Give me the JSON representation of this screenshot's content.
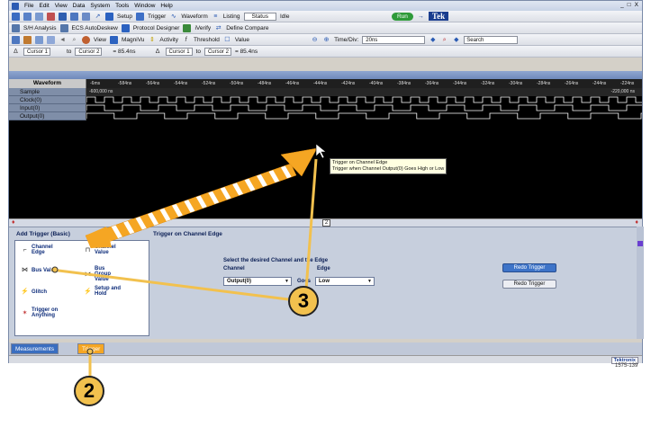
{
  "menu": [
    "File",
    "Edit",
    "View",
    "Data",
    "System",
    "Tools",
    "Window",
    "Help"
  ],
  "window_controls": [
    "_",
    "□",
    "X"
  ],
  "toolbar1": {
    "setup": "Setup",
    "trigger": "Trigger",
    "waveform": "Waveform",
    "listing": "Listing",
    "status_box": "Status",
    "status_value": "Idle",
    "run": "Run",
    "tek": "Tek"
  },
  "toolbar2": {
    "analysis": "S/H Analysis",
    "autodeskew": "ECS AutoDeskew",
    "protocol": "Protocol Designer",
    "verify": "iVerify",
    "define_compare": "Define Compare"
  },
  "toolbar3": {
    "view": "View",
    "magniview": "MagniVu",
    "activity": "Activity",
    "threshold": "Threshold",
    "value": "Value",
    "timediv_label": "Time/Div:",
    "timediv_value": "20ns",
    "search_label": "Search"
  },
  "toolbar4": {
    "cursor1": "Cursor 1",
    "to": "to",
    "cursor2": "Cursor 2",
    "delta": "= 85.4ns",
    "cursor1b": "Cursor 1",
    "to2": "to",
    "cursor2b": "Cursor 2",
    "delta2": "= 85.4ns"
  },
  "waveform": {
    "header": "Waveform",
    "rows": [
      "Sample",
      "Clock(0)",
      "Input(0)",
      "Output(0)"
    ],
    "time_ticks": [
      "-6ms",
      "-584ns",
      "-564ns",
      "-544ns",
      "-524ns",
      "-504ns",
      "-484ns",
      "-464ns",
      "-444ns",
      "-424ns",
      "-404ns",
      "-384ns",
      "-364ns",
      "-344ns",
      "-324ns",
      "-304ns",
      "-284ns",
      "-264ns",
      "-244ns",
      "-224ns"
    ],
    "sample_left": "-600,000 ns",
    "sample_right": "-220,000 ns",
    "marker": "2"
  },
  "tooltip": {
    "line1": "Trigger on Channel Edge",
    "line2": "Trigger when Channel Output(0) Goes High or Low"
  },
  "add_trigger": {
    "title": "Add Trigger (Basic)",
    "items": [
      {
        "label": "Channel Edge",
        "icon": "channel-edge-icon"
      },
      {
        "label": "Channel Value",
        "icon": "channel-value-icon"
      },
      {
        "label": "Bus Value",
        "icon": "bus-value-icon"
      },
      {
        "label": "Bus Group Value",
        "icon": "bus-group-value-icon"
      },
      {
        "label": "Glitch",
        "icon": "glitch-icon"
      },
      {
        "label": "Setup and Hold",
        "icon": "setup-hold-icon"
      },
      {
        "label": "Trigger on Anything",
        "icon": "trigger-anything-icon"
      }
    ]
  },
  "trigger_config": {
    "title": "Trigger on Channel Edge",
    "instruction": "Select the desired Channel and the Edge",
    "channel_label": "Channel",
    "edge_label": "Edge",
    "goes": "Goes",
    "channel_value": "Output(0)",
    "edge_value": "Low",
    "advanced_button": "Redo Trigger",
    "redo_button": "Redo Trigger"
  },
  "bottom_tabs": [
    "Measurements",
    "Trigger"
  ],
  "status_logo": "Tektronix",
  "figure_number": "1575-139",
  "callouts": [
    "2",
    "3"
  ],
  "colors": {
    "app_bg": "#d4d0c8",
    "waveform_bg": "#000000",
    "trace": "#ffffff",
    "arrow": "#f5a623",
    "callout": "#f2c14e",
    "panel": "#c7cfdd"
  }
}
